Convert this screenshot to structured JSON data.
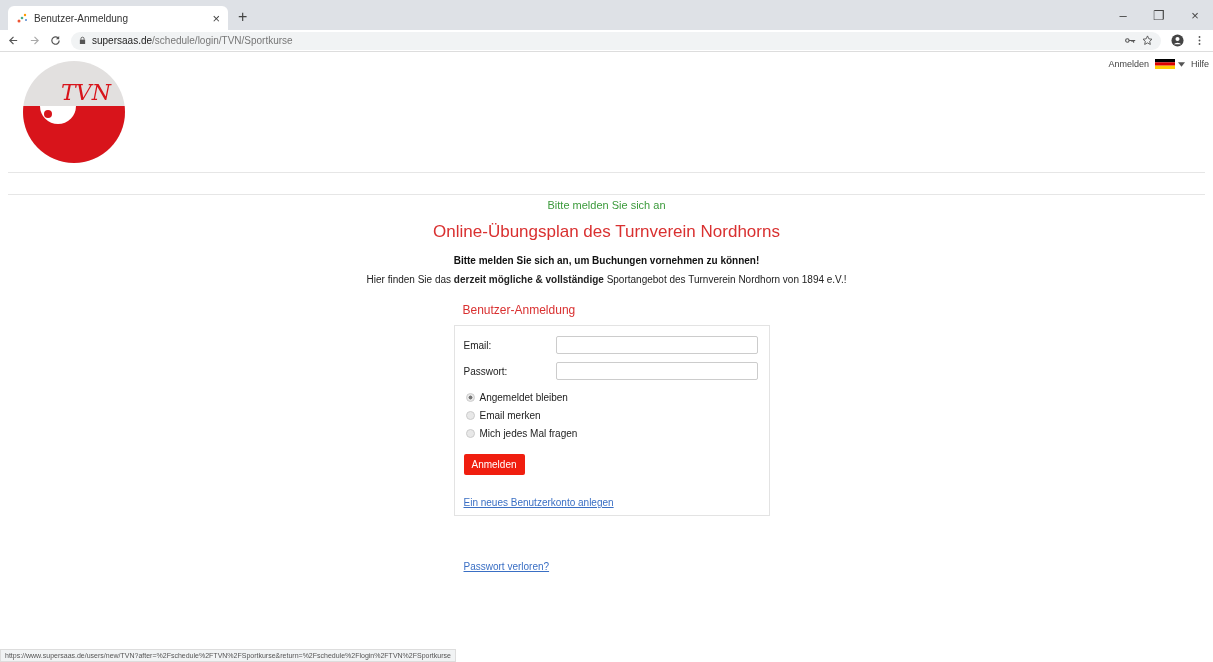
{
  "browser": {
    "tab_title": "Benutzer-Anmeldung",
    "tab_close": "×",
    "new_tab": "+",
    "url_host": "supersaas.de",
    "url_path": "/schedule/login/TVN/Sportkurse",
    "window_controls": [
      "–",
      "❐",
      "×"
    ]
  },
  "header": {
    "logo_text": "TVN",
    "links": [
      {
        "kind": "link",
        "label": "Anmelden"
      },
      {
        "kind": "flag"
      },
      {
        "kind": "link",
        "label": "Hilfe"
      }
    ]
  },
  "notice": "Bitte melden Sie sich an",
  "title": "Online-Übungsplan des Turnverein Nordhorns",
  "intro_bold": "Bitte melden Sie sich an, um Buchungen vornehmen zu können!",
  "intro": "Hier finden Sie das **derzeit mögliche & vollständige** Sportangebot des Turnverein Nordhorn von 1894 e.V.!",
  "login": {
    "heading": "Benutzer-Anmeldung",
    "fields": [
      {
        "label": "Email:"
      },
      {
        "label": "Passwort:"
      }
    ],
    "options": [
      {
        "label": "Angemeldet bleiben",
        "selected": true
      },
      {
        "label": "Email merken",
        "selected": false
      },
      {
        "label": "Mich jedes Mal fragen",
        "selected": false
      }
    ],
    "submit": "Anmelden",
    "register_link": "Ein neues Benutzerkonto anlegen"
  },
  "lost_password": "Passwort verloren?",
  "status_url": "https://www.supersaas.de/users/new/TVN?after=%2Fschedule%2FTVN%2FSportkurse&return=%2Fschedule%2Flogin%2FTVN%2FSportkurse"
}
